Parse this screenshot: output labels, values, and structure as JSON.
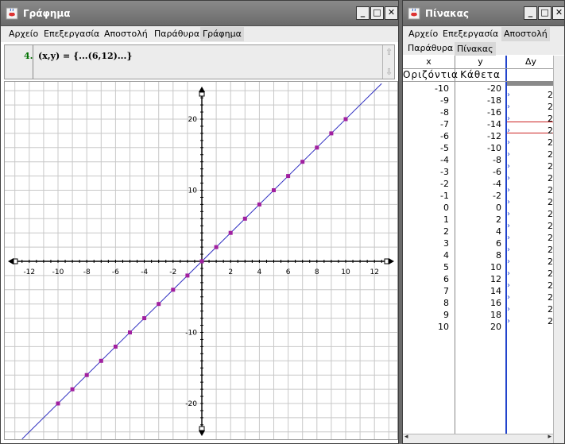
{
  "graph_window": {
    "title": "Γράφημα",
    "menu": [
      "Αρχείο",
      "Επεξεργασία",
      "Αποστολή",
      "Παράθυρα",
      "Γράφημα"
    ],
    "buttons": {
      "minimize": "_",
      "maximize": "□",
      "close": "✕"
    },
    "algebra": {
      "number": "4.",
      "expression": "(x,y) = {...(6,12)...}"
    },
    "axis": {
      "x_ticks": [
        -12,
        -10,
        -8,
        -6,
        -4,
        -2,
        2,
        4,
        6,
        8,
        10,
        12
      ],
      "y_ticks": [
        -20,
        -10,
        10,
        20
      ]
    }
  },
  "table_window": {
    "title": "Πίνακας",
    "menu": [
      "Αρχείο",
      "Επεξεργασία",
      "Αποστολή"
    ],
    "submenu": [
      "Παράθυρα",
      "Πίνακας"
    ],
    "columns": [
      "x",
      "y",
      "Δy"
    ],
    "column_labels": [
      "Οριζόντια",
      "Κάθετα"
    ],
    "delta_values": [
      "2",
      "2",
      "2",
      "2",
      "2",
      "2",
      "2",
      "2",
      "2",
      "2",
      "2",
      "2",
      "2",
      "2",
      "2",
      "2",
      "2",
      "2",
      "2",
      "2"
    ]
  },
  "chart_data": {
    "type": "scatter",
    "title": "",
    "xlabel": "",
    "ylabel": "",
    "xlim": [
      -12.5,
      12.5
    ],
    "ylim": [
      -24,
      24
    ],
    "grid": true,
    "line": {
      "slope": 2,
      "intercept": 0
    },
    "x": [
      -10,
      -9,
      -8,
      -7,
      -6,
      -5,
      -4,
      -3,
      -2,
      -1,
      0,
      1,
      2,
      3,
      4,
      5,
      6,
      7,
      8,
      9,
      10
    ],
    "y": [
      -20,
      -18,
      -16,
      -14,
      -12,
      -10,
      -8,
      -6,
      -4,
      -2,
      0,
      2,
      4,
      6,
      8,
      10,
      12,
      14,
      16,
      18,
      20
    ],
    "x_display": [
      "-10",
      "-9",
      "-8",
      "-7",
      "-6",
      "-5",
      "-4",
      "-3",
      "-2",
      "-1",
      "0",
      "1",
      "2",
      "3",
      "4",
      "5",
      "6",
      "7",
      "8",
      "9",
      "10"
    ],
    "y_display": [
      "-20",
      "-18",
      "-16",
      "-14",
      "-12",
      "-10",
      "-8",
      "-6",
      "-4",
      "-2",
      "0",
      "2",
      "4",
      "6",
      "8",
      "10",
      "12",
      "14",
      "16",
      "18",
      "20"
    ],
    "point_color": "#a020a0",
    "line_color": "#3030c0"
  },
  "colors": {
    "titlebar": "#7a7a7a",
    "grid": "#c8c8c8",
    "axis": "#000000",
    "accent_blue": "#2244cc",
    "highlight_red": "#cc2222"
  }
}
